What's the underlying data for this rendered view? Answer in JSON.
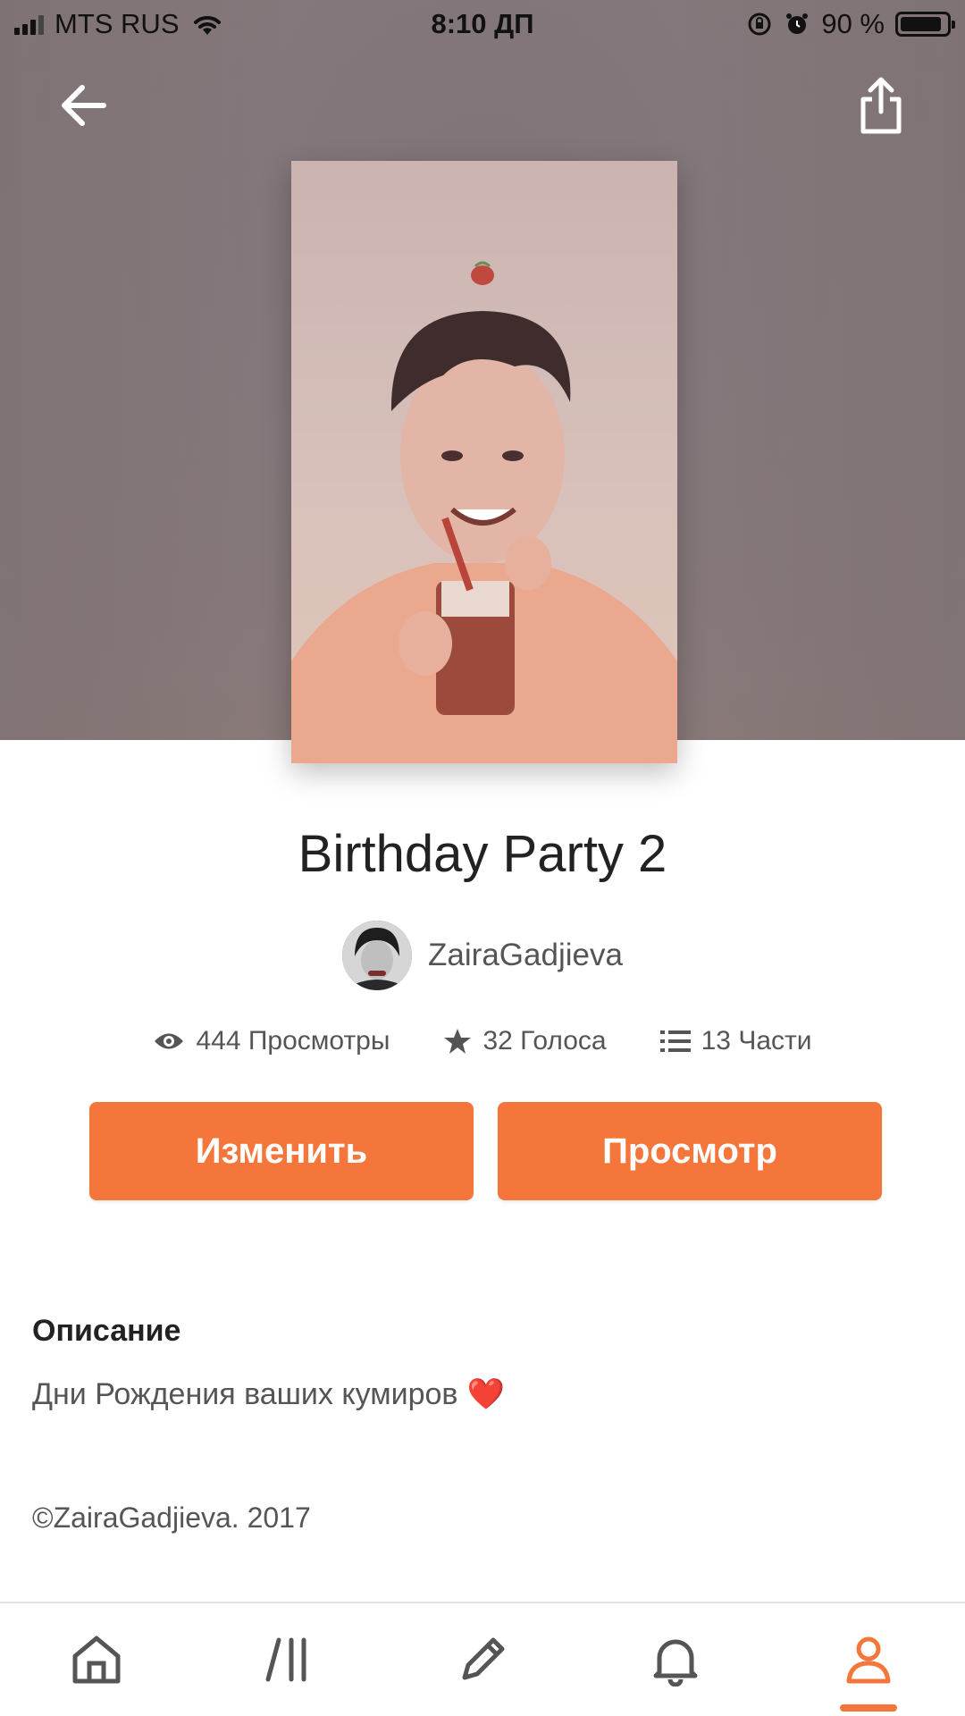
{
  "status_bar": {
    "carrier": "MTS RUS",
    "time": "8:10 ДП",
    "battery_text": "90 %",
    "battery_level": 0.9
  },
  "story": {
    "title": "Birthday Party 2",
    "author": "ZairaGadjieva",
    "views": "444 Просмотры",
    "votes": "32 Голоса",
    "parts": "13 Части"
  },
  "actions": {
    "edit_label": "Изменить",
    "view_label": "Просмотр"
  },
  "description": {
    "heading": "Описание",
    "text": "Дни Рождения ваших кумиров",
    "emoji": "❤️",
    "copyright": "©ZairaGadjieva. 2017"
  },
  "tabs": [
    {
      "icon": "home-icon",
      "active": false
    },
    {
      "icon": "library-icon",
      "active": false
    },
    {
      "icon": "write-icon",
      "active": false
    },
    {
      "icon": "bell-icon",
      "active": false
    },
    {
      "icon": "profile-icon",
      "active": true
    }
  ],
  "colors": {
    "accent": "#f5763b",
    "hero": "#857a7c"
  }
}
